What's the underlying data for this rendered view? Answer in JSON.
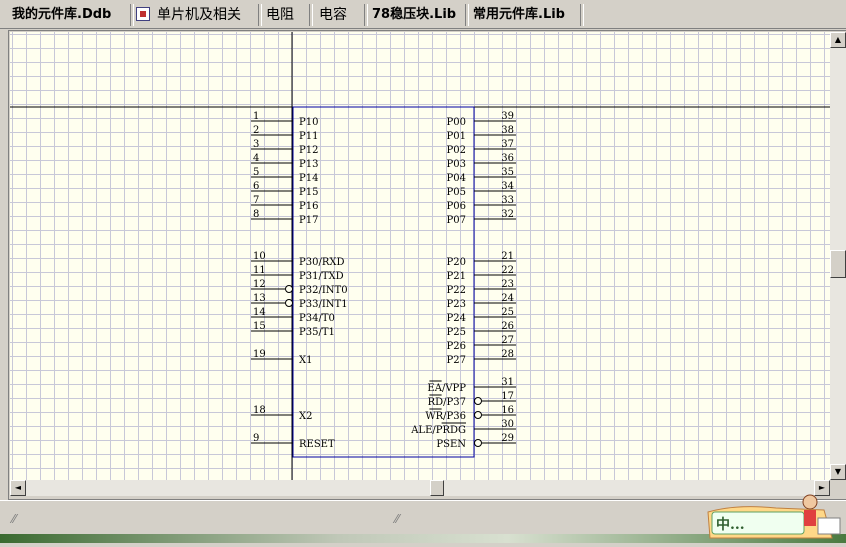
{
  "tabs": [
    {
      "label": "我的元件库.Ddb",
      "bold": true
    },
    {
      "label": "单片机及相关",
      "bold": false,
      "active": true
    },
    {
      "label": "电阻",
      "bold": false
    },
    {
      "label": "电容",
      "bold": false
    },
    {
      "label": "78稳压块.Lib",
      "bold": true
    },
    {
      "label": "常用元件库.Lib",
      "bold": true
    }
  ],
  "component": {
    "left_pins": [
      {
        "num": "1",
        "name": "P10"
      },
      {
        "num": "2",
        "name": "P11"
      },
      {
        "num": "3",
        "name": "P12"
      },
      {
        "num": "4",
        "name": "P13"
      },
      {
        "num": "5",
        "name": "P14"
      },
      {
        "num": "6",
        "name": "P15"
      },
      {
        "num": "7",
        "name": "P16"
      },
      {
        "num": "8",
        "name": "P17"
      },
      {
        "num": "10",
        "name": "P30/RXD"
      },
      {
        "num": "11",
        "name": "P31/TXD"
      },
      {
        "num": "12",
        "name": "P32/INT0",
        "inverted": true
      },
      {
        "num": "13",
        "name": "P33/INT1",
        "inverted": true
      },
      {
        "num": "14",
        "name": "P34/T0"
      },
      {
        "num": "15",
        "name": "P35/T1"
      },
      {
        "num": "19",
        "name": "X1"
      },
      {
        "num": "18",
        "name": "X2"
      },
      {
        "num": "9",
        "name": "RESET"
      }
    ],
    "right_pins": [
      {
        "num": "39",
        "name": "P00"
      },
      {
        "num": "38",
        "name": "P01"
      },
      {
        "num": "37",
        "name": "P02"
      },
      {
        "num": "36",
        "name": "P03"
      },
      {
        "num": "35",
        "name": "P04"
      },
      {
        "num": "34",
        "name": "P05"
      },
      {
        "num": "33",
        "name": "P06"
      },
      {
        "num": "32",
        "name": "P07"
      },
      {
        "num": "21",
        "name": "P20"
      },
      {
        "num": "22",
        "name": "P21"
      },
      {
        "num": "23",
        "name": "P22"
      },
      {
        "num": "24",
        "name": "P23"
      },
      {
        "num": "25",
        "name": "P24"
      },
      {
        "num": "26",
        "name": "P25"
      },
      {
        "num": "27",
        "name": "P26"
      },
      {
        "num": "28",
        "name": "P27"
      },
      {
        "num": "31",
        "name": "EA/VPP",
        "overbar": "EA"
      },
      {
        "num": "17",
        "name": "RD/P37",
        "inverted": true,
        "overbar": "RD"
      },
      {
        "num": "16",
        "name": "WR/P36",
        "inverted": true,
        "overbar": "WR"
      },
      {
        "num": "30",
        "name": "ALE/PRDG",
        "overbar": "PRDG"
      },
      {
        "num": "29",
        "name": "PSEN",
        "inverted": true
      }
    ]
  },
  "scroll": {
    "up": "▲",
    "down": "▼",
    "left": "◄",
    "right": "►"
  },
  "logo": {
    "text": "中..."
  },
  "colors": {
    "grid": "#c8c8d8",
    "canvas": "#ffffef",
    "body_outline": "#0000a0"
  }
}
